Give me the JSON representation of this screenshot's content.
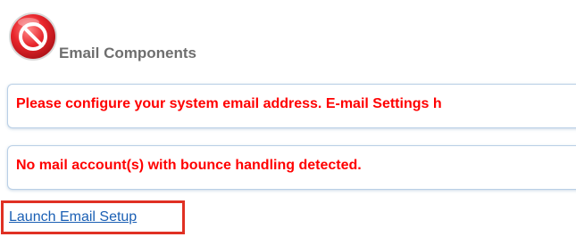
{
  "header": {
    "title": "Email Components",
    "icon": "no-entry-icon"
  },
  "alerts": [
    {
      "text": "Please configure your system email address. E-mail Settings h"
    },
    {
      "text": "No mail account(s) with bounce handling detected."
    }
  ],
  "actions": {
    "launch_label": "Launch Email Setup"
  },
  "colors": {
    "alert_text": "#ff0000",
    "icon_red": "#e8252b",
    "link_blue": "#1a5fb4",
    "highlight_border": "#e03023",
    "title_gray": "#6e6e6e"
  }
}
